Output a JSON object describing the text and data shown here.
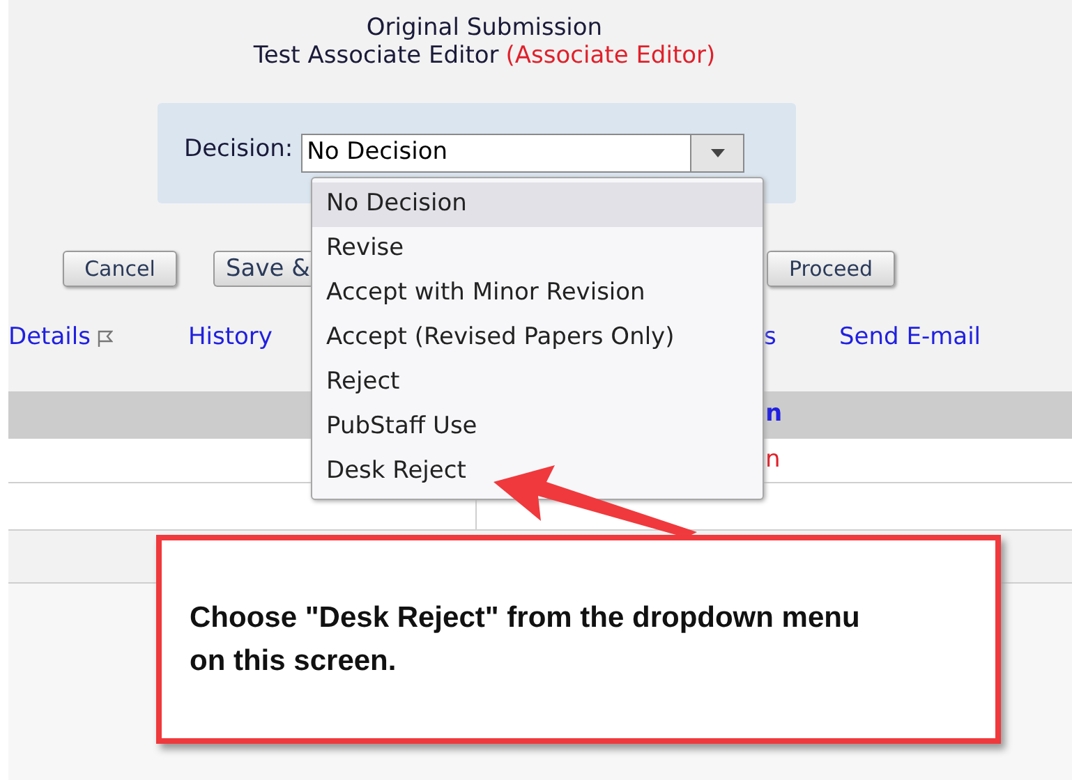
{
  "header": {
    "title": "Original Submission",
    "editor_name": "Test Associate Editor",
    "editor_role": "(Associate Editor)"
  },
  "decision": {
    "label": "Decision:",
    "value": "No Decision",
    "expanded": true,
    "options": [
      {
        "label": "No Decision",
        "selected": true
      },
      {
        "label": "Revise",
        "selected": false
      },
      {
        "label": "Accept with Minor Revision",
        "selected": false
      },
      {
        "label": "Accept (Revised Papers Only)",
        "selected": false
      },
      {
        "label": "Reject",
        "selected": false
      },
      {
        "label": "PubStaff Use",
        "selected": false
      },
      {
        "label": "Desk Reject",
        "selected": false
      }
    ]
  },
  "buttons": [
    "Cancel",
    "Save &",
    "Proceed"
  ],
  "links": [
    {
      "label": "Details",
      "flagged": true
    },
    {
      "label": "History",
      "flagged": false
    },
    {
      "label": "s",
      "flagged": false
    },
    {
      "label": "Send E-mail",
      "flagged": false
    }
  ],
  "table": {
    "header_cell": "n",
    "row_cell": "n"
  },
  "callout": {
    "text": "Choose \"Desk Reject\" from the dropdown menu on this screen."
  }
}
